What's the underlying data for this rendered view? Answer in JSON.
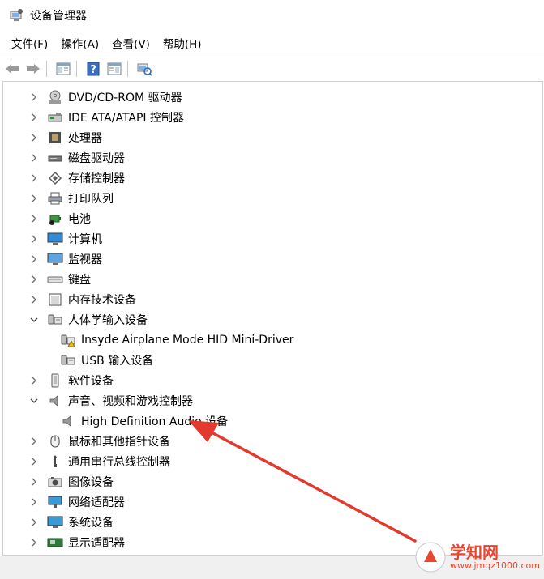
{
  "window": {
    "title": "设备管理器",
    "icon": "device-manager-icon"
  },
  "menu": [
    {
      "label": "文件(F)"
    },
    {
      "label": "操作(A)"
    },
    {
      "label": "查看(V)"
    },
    {
      "label": "帮助(H)"
    }
  ],
  "toolbar": [
    {
      "icon": "back-arrow-icon"
    },
    {
      "icon": "forward-arrow-icon"
    },
    {
      "icon": "properties-icon"
    },
    {
      "icon": "help-icon"
    },
    {
      "icon": "show-hide-console-icon"
    },
    {
      "icon": "scan-hardware-icon"
    }
  ],
  "tree": [
    {
      "label": "DVD/CD-ROM 驱动器",
      "level": 0,
      "state": "collapsed",
      "icon": "dvd-drive-icon"
    },
    {
      "label": "IDE ATA/ATAPI 控制器",
      "level": 0,
      "state": "collapsed",
      "icon": "ide-controller-icon"
    },
    {
      "label": "处理器",
      "level": 0,
      "state": "collapsed",
      "icon": "processor-icon"
    },
    {
      "label": "磁盘驱动器",
      "level": 0,
      "state": "collapsed",
      "icon": "disk-drive-icon"
    },
    {
      "label": "存储控制器",
      "level": 0,
      "state": "collapsed",
      "icon": "storage-controller-icon"
    },
    {
      "label": "打印队列",
      "level": 0,
      "state": "collapsed",
      "icon": "printer-icon"
    },
    {
      "label": "电池",
      "level": 0,
      "state": "collapsed",
      "icon": "battery-icon"
    },
    {
      "label": "计算机",
      "level": 0,
      "state": "collapsed",
      "icon": "computer-icon"
    },
    {
      "label": "监视器",
      "level": 0,
      "state": "collapsed",
      "icon": "monitor-icon"
    },
    {
      "label": "键盘",
      "level": 0,
      "state": "collapsed",
      "icon": "keyboard-icon"
    },
    {
      "label": "内存技术设备",
      "level": 0,
      "state": "collapsed",
      "icon": "memory-device-icon"
    },
    {
      "label": "人体学输入设备",
      "level": 0,
      "state": "expanded",
      "icon": "hid-icon"
    },
    {
      "label": "Insyde Airplane Mode HID Mini-Driver",
      "level": 1,
      "state": "leaf",
      "icon": "hid-warning-icon"
    },
    {
      "label": "USB 输入设备",
      "level": 1,
      "state": "leaf",
      "icon": "hid-icon"
    },
    {
      "label": "软件设备",
      "level": 0,
      "state": "collapsed",
      "icon": "software-device-icon"
    },
    {
      "label": "声音、视频和游戏控制器",
      "level": 0,
      "state": "expanded",
      "icon": "speaker-icon"
    },
    {
      "label": "High Definition Audio 设备",
      "level": 1,
      "state": "leaf",
      "icon": "speaker-icon"
    },
    {
      "label": "鼠标和其他指针设备",
      "level": 0,
      "state": "collapsed",
      "icon": "mouse-icon"
    },
    {
      "label": "通用串行总线控制器",
      "level": 0,
      "state": "collapsed",
      "icon": "usb-controller-icon"
    },
    {
      "label": "图像设备",
      "level": 0,
      "state": "collapsed",
      "icon": "camera-icon"
    },
    {
      "label": "网络适配器",
      "level": 0,
      "state": "collapsed",
      "icon": "network-adapter-icon"
    },
    {
      "label": "系统设备",
      "level": 0,
      "state": "collapsed",
      "icon": "system-device-icon"
    },
    {
      "label": "显示适配器",
      "level": 0,
      "state": "collapsed",
      "icon": "display-adapter-icon"
    }
  ],
  "watermark": {
    "brand": "学知网",
    "url": "www.jmqz1000.com"
  },
  "colors": {
    "arrow": "#e23a2e",
    "accent": "#2b7bd6"
  }
}
